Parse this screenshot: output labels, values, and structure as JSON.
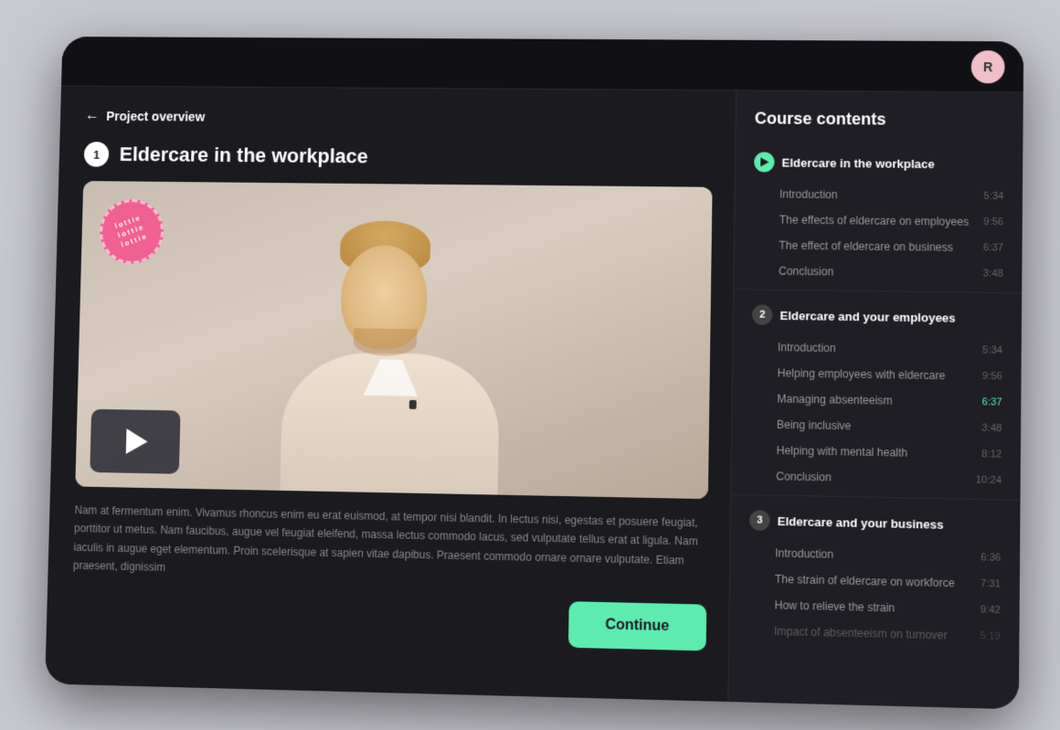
{
  "app": {
    "avatar_initial": "R"
  },
  "header": {
    "back_label": "Project overview"
  },
  "lesson": {
    "number": "1",
    "title": "Eldercare in the workplace",
    "description": "Nam at fermentum enim. Vivamus rhoncus enim eu erat euismod, at tempor nisi blandit. In lectus nisi, egestas et posuere feugiat, porttitor ut metus. Nam faucibus, augue vel feugiat eleifend, massa lectus commodo lacus, sed vulputate tellus erat at ligula. Nam iaculis in augue eget elementum. Proin scelerisque at sapien vitae dapibus. Praesent commodo ornare ornare vulputate. Etiam praesent, dignissim",
    "continue_label": "Continue"
  },
  "brand": {
    "text_line1": "lottie",
    "text_line2": "lottie",
    "text_line3": "lottie"
  },
  "course_contents": {
    "title": "Course contents",
    "sections": [
      {
        "id": 1,
        "label": "Eldercare in the workplace",
        "is_current": true,
        "lessons": [
          {
            "name": "Introduction",
            "time": "5:34",
            "is_active": false,
            "time_highlight": false
          },
          {
            "name": "The effects of eldercare on employees",
            "time": "9:56",
            "is_active": false,
            "time_highlight": false
          },
          {
            "name": "The effect of eldercare on business",
            "time": "6:37",
            "is_active": false,
            "time_highlight": false
          },
          {
            "name": "Conclusion",
            "time": "3:48",
            "is_active": false,
            "time_highlight": false
          }
        ]
      },
      {
        "id": 2,
        "label": "Eldercare and your employees",
        "is_current": false,
        "lessons": [
          {
            "name": "Introduction",
            "time": "5:34",
            "is_active": false,
            "time_highlight": false
          },
          {
            "name": "Helping employees with eldercare",
            "time": "9:56",
            "is_active": false,
            "time_highlight": false
          },
          {
            "name": "Managing absenteeism",
            "time": "6:37",
            "is_active": false,
            "time_highlight": true
          },
          {
            "name": "Being inclusive",
            "time": "3:48",
            "is_active": false,
            "time_highlight": false
          },
          {
            "name": "Helping with mental health",
            "time": "8:12",
            "is_active": false,
            "time_highlight": false
          },
          {
            "name": "Conclusion",
            "time": "10:24",
            "is_active": false,
            "time_highlight": false
          }
        ]
      },
      {
        "id": 3,
        "label": "Eldercare and your business",
        "is_current": false,
        "lessons": [
          {
            "name": "Introduction",
            "time": "6:36",
            "is_active": false,
            "time_highlight": false
          },
          {
            "name": "The strain of eldercare on workforce",
            "time": "7:31",
            "is_active": false,
            "time_highlight": false
          },
          {
            "name": "How to relieve the strain",
            "time": "9:42",
            "is_active": false,
            "time_highlight": false
          },
          {
            "name": "Impact of absenteeism on turnover",
            "time": "5:19",
            "is_active": false,
            "time_highlight": false
          }
        ]
      }
    ]
  }
}
